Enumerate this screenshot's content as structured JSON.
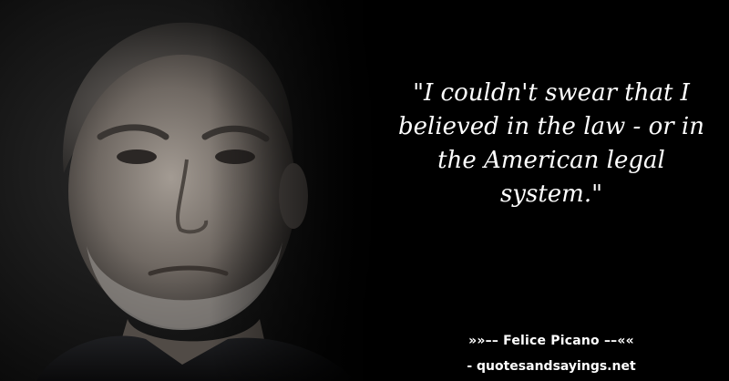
{
  "quote": {
    "text": "\"I couldn't swear that I believed in the law - or in the American legal system.\""
  },
  "attribution": {
    "text": "»»–– Felice Picano ––««"
  },
  "source": {
    "text": "- quotesandsayings.net"
  },
  "colors": {
    "background": "#000000",
    "text": "#ffffff"
  }
}
